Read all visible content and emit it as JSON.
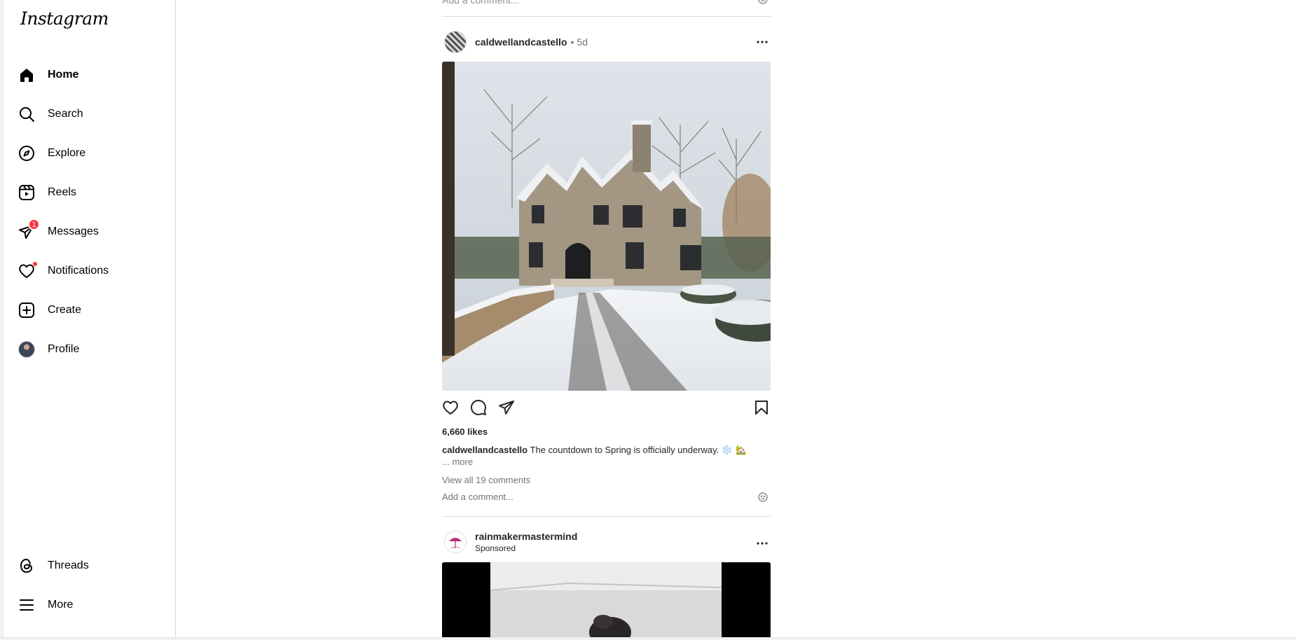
{
  "app": {
    "logo_text": "Instagram"
  },
  "sidebar": {
    "items": [
      {
        "label": "Home",
        "icon": "home-icon",
        "active": true
      },
      {
        "label": "Search",
        "icon": "search-icon"
      },
      {
        "label": "Explore",
        "icon": "compass-icon"
      },
      {
        "label": "Reels",
        "icon": "reels-icon"
      },
      {
        "label": "Messages",
        "icon": "messenger-icon",
        "badge": "1"
      },
      {
        "label": "Notifications",
        "icon": "heart-icon",
        "dot": true
      },
      {
        "label": "Create",
        "icon": "plus-square-icon"
      },
      {
        "label": "Profile",
        "icon": "avatar"
      }
    ],
    "bottom_items": [
      {
        "label": "Threads",
        "icon": "threads-icon"
      },
      {
        "label": "More",
        "icon": "menu-icon"
      }
    ]
  },
  "previous_post": {
    "add_comment_placeholder": "Add a comment..."
  },
  "post": {
    "username": "caldwellandcastello",
    "time_separator": "•",
    "time": "5d",
    "likes": "6,660 likes",
    "caption_user": "caldwellandcastello",
    "caption_text": "The countdown to Spring is officially underway. ❄️ 🏡",
    "more_text": "... more",
    "view_comments": "View all 19 comments",
    "add_comment_placeholder": "Add a comment..."
  },
  "sponsored_post": {
    "username": "rainmakermastermind",
    "subtitle": "Sponsored"
  },
  "colors": {
    "accent_badge": "#ff3040",
    "text": "#262626",
    "muted": "#737373",
    "divider": "#dbdbdb"
  }
}
